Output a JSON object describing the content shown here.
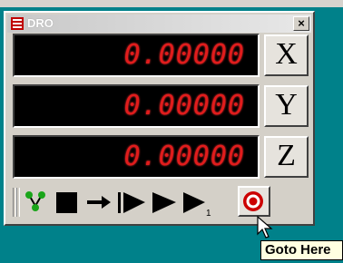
{
  "window": {
    "title": "DRO",
    "close_label": "×"
  },
  "axes": [
    {
      "axis": "X",
      "value": "0.00000"
    },
    {
      "axis": "Y",
      "value": "0.00000"
    },
    {
      "axis": "Z",
      "value": "0.00000"
    }
  ],
  "toolbar": {
    "buttons": [
      "tool-icon",
      "stop-icon",
      "step-arrow-icon",
      "step-play-icon",
      "play-icon",
      "single-step-icon",
      "target-icon"
    ],
    "tooltip": "Goto Here"
  },
  "colors": {
    "digits": "#e11c1c",
    "desktop": "#00818a",
    "face": "#d4d0c8"
  }
}
